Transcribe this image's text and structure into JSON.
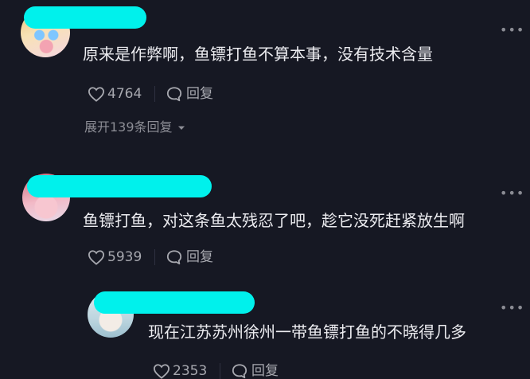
{
  "comments": [
    {
      "text": "原来是作弊啊，鱼镖打鱼不算本事，没有技术含量",
      "likes": "4764",
      "reply_label": "回复",
      "expand_label": "展开139条回复"
    },
    {
      "text": "鱼镖打鱼，对这条鱼太残忍了吧，趁它没死赶紧放生啊",
      "likes": "5939",
      "reply_label": "回复"
    }
  ],
  "reply": {
    "text": "现在江苏苏州徐州一带鱼镖打鱼的不晓得几多",
    "likes": "2353",
    "reply_label": "回复"
  },
  "more_glyph": "•••",
  "icons": {
    "like": "heart-outline-icon",
    "reply": "speech-bubble-icon",
    "more": "more-dots-icon",
    "expand": "chevron-down-icon"
  },
  "colors": {
    "background": "#161823",
    "redaction": "#00f1ec"
  }
}
